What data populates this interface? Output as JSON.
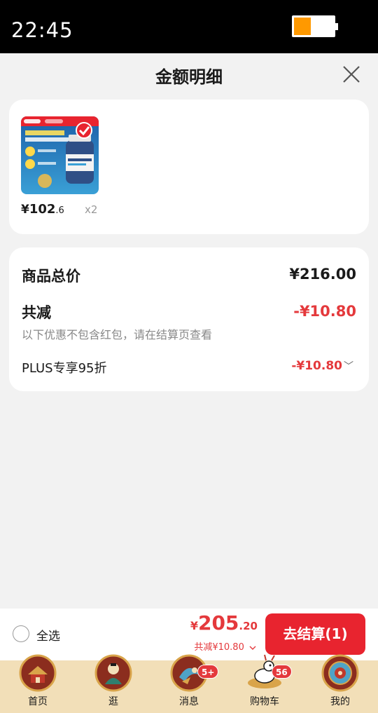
{
  "status_bar": {
    "time": "22:45"
  },
  "sheet": {
    "title": "金额明细"
  },
  "product": {
    "price_symbol": "¥",
    "price_int": "102",
    "price_dec": ".6",
    "quantity": "x2"
  },
  "summary": {
    "total_label": "商品总价",
    "total_value": "¥216.00",
    "reduce_label": "共减",
    "reduce_value": "-¥10.80",
    "note": "以下优惠不包含红包，请在结算页查看",
    "plus_label": "PLUS专享95折",
    "plus_value": "-¥10.80"
  },
  "checkout": {
    "select_all": "全选",
    "total_symbol": "¥",
    "total_int": "205",
    "total_dec": ".20",
    "discount": "共减¥10.80",
    "button": "去结算(1)"
  },
  "tabs": [
    {
      "label": "首页",
      "icon": "home-icon"
    },
    {
      "label": "逛",
      "icon": "browse-icon"
    },
    {
      "label": "消息",
      "icon": "messages-icon",
      "badge": "5+"
    },
    {
      "label": "购物车",
      "icon": "cart-icon",
      "badge": "56"
    },
    {
      "label": "我的",
      "icon": "profile-icon"
    }
  ],
  "colors": {
    "accent_red": "#e4393c",
    "button_red": "#e8242f",
    "battery": "#ff9900",
    "tabbar_bg": "#f2dfb8"
  }
}
